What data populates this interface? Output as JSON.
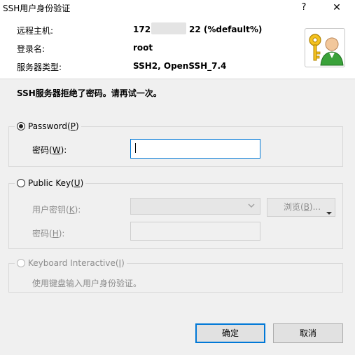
{
  "window": {
    "title": "SSH用户身份验证",
    "help_glyph": "?",
    "close_glyph": "✕"
  },
  "info": {
    "host_label": "远程主机:",
    "host_value_prefix": "172.",
    "host_value_suffix": "22 (%default%)",
    "login_label": "登录名:",
    "login_value": "root",
    "server_type_label": "服务器类型:",
    "server_type_value": "SSH2, OpenSSH_7.4"
  },
  "message": "SSH服务器拒绝了密码。请再试一次。",
  "password_section": {
    "radio_label": "Password(",
    "radio_key": "P",
    "radio_close": ")",
    "field_label": "密码(",
    "field_key": "W",
    "field_close": "):",
    "value": ""
  },
  "publickey_section": {
    "radio_label": "Public Key(",
    "radio_key": "U",
    "radio_close": ")",
    "key_label": "用户密钥(",
    "key_key": "K",
    "key_close": "):",
    "browse_label": "浏览(",
    "browse_key": "B",
    "browse_close": ")...",
    "pass_label": "密码(",
    "pass_key": "H",
    "pass_close": "):"
  },
  "keyboard_section": {
    "radio_label": "Keyboard Interactive(",
    "radio_key": "I",
    "radio_close": ")",
    "description": "使用键盘输入用户身份验证。"
  },
  "buttons": {
    "ok": "确定",
    "cancel": "取消"
  },
  "colors": {
    "accent": "#0078d7",
    "dialog_bg": "#f0f0f0",
    "disabled_text": "#8d8d8d"
  },
  "icons": {
    "auth": "key-user-icon",
    "dropdown": "chevron-down-icon"
  }
}
